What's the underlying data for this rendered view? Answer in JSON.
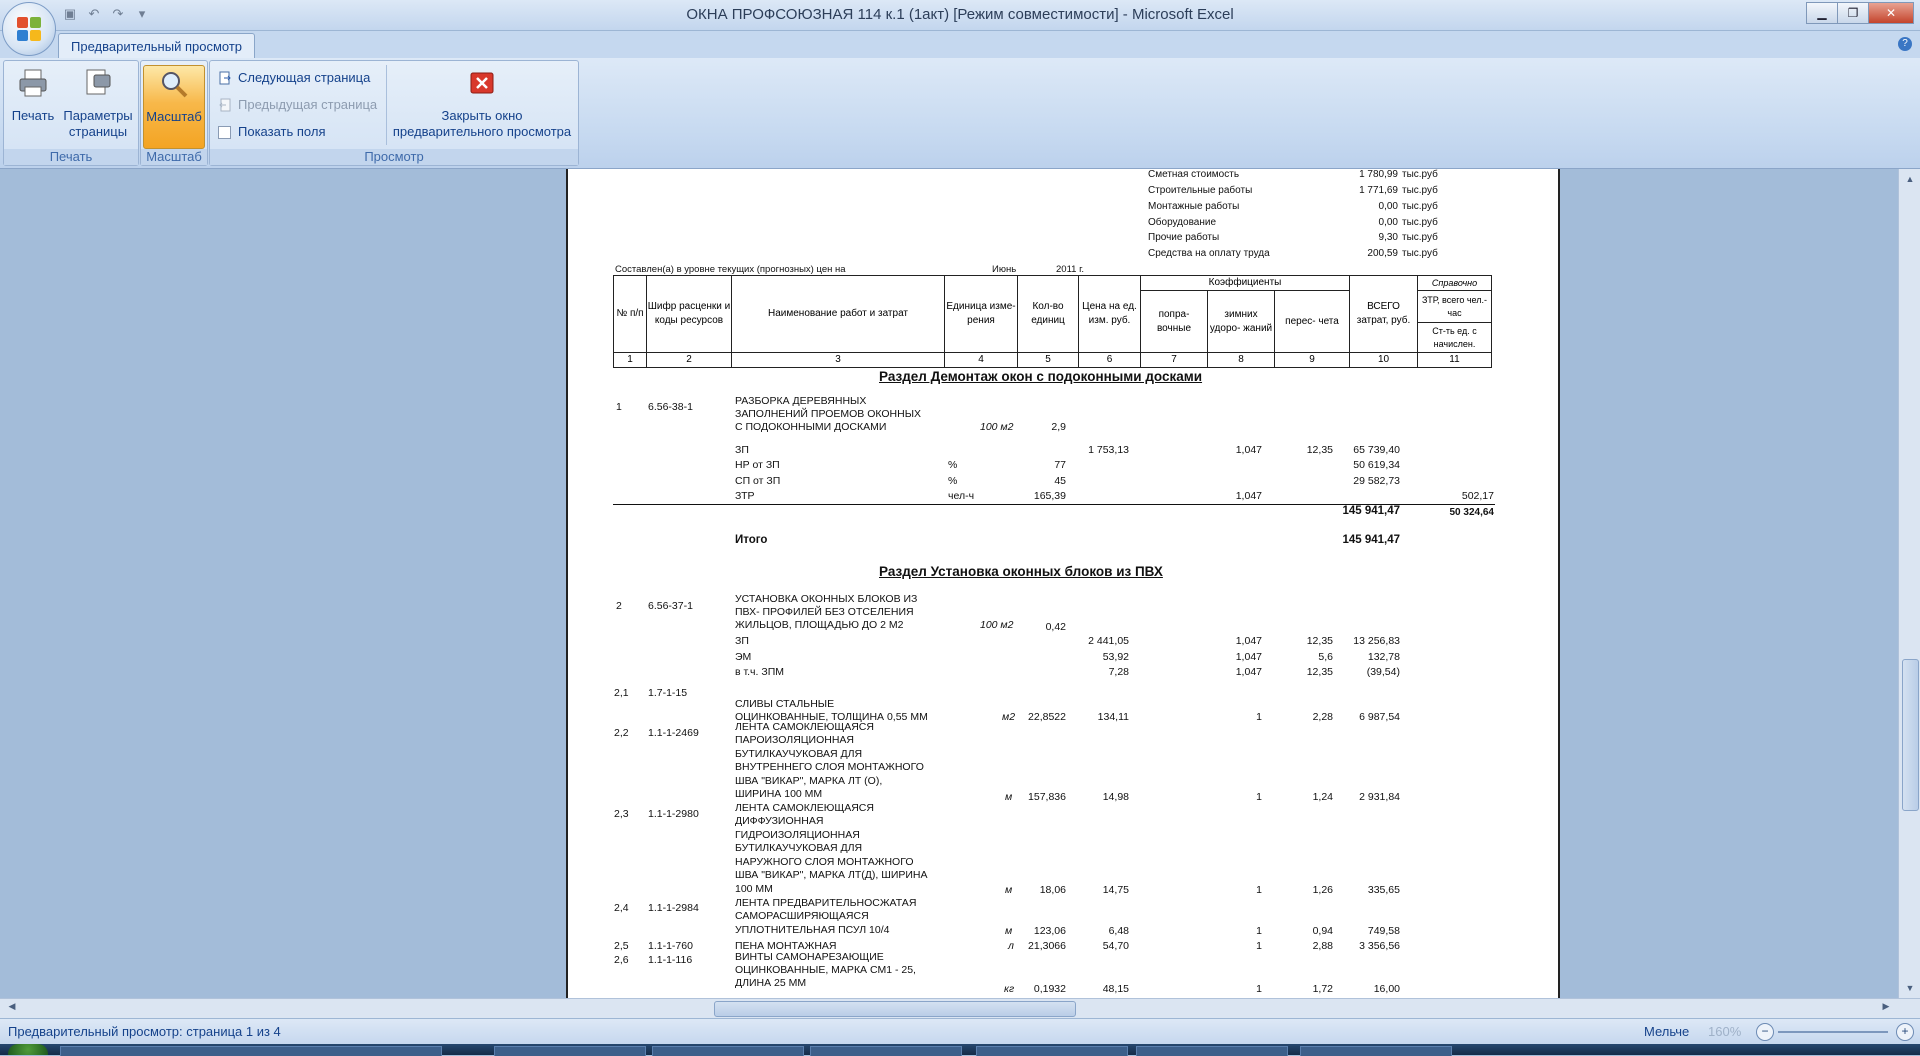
{
  "window": {
    "title": "ОКНА ПРОФСОЮЗНАЯ 114 к.1 (1акт)  [Режим совместимости]  - Microsoft Excel"
  },
  "ribbon": {
    "tab": "Предварительный просмотр",
    "print_label": "Печать",
    "page_setup_label": "Параметры страницы",
    "zoom_label": "Масштаб",
    "next_page": "Следующая страница",
    "prev_page": "Предыдущая страница",
    "show_margins": "Показать поля",
    "close_preview": "Закрыть окно предварительного просмотра",
    "group_print": "Печать",
    "group_zoom": "Масштаб",
    "group_preview": "Просмотр"
  },
  "status": {
    "text": "Предварительный просмотр: страница 1 из 4",
    "zoom_label": "Мельче",
    "zoom_value": "160%"
  },
  "sheet": {
    "summary": [
      {
        "label": "Сметная стоимость",
        "value": "1 780,99",
        "unit": "тыс.руб"
      },
      {
        "label": "Строительные работы",
        "value": "1 771,69",
        "unit": "тыс.руб"
      },
      {
        "label": "Монтажные работы",
        "value": "0,00",
        "unit": "тыс.руб"
      },
      {
        "label": "Оборудование",
        "value": "0,00",
        "unit": "тыс.руб"
      },
      {
        "label": "Прочие работы",
        "value": "9,30",
        "unit": "тыс.руб"
      },
      {
        "label": "Средства на оплату труда",
        "value": "200,59",
        "unit": "тыс.руб"
      }
    ],
    "compiled_text": "Составлен(а) в уровне текущих (прогнозных) цен на",
    "compiled_month": "Июнь",
    "compiled_year": "2011  г.",
    "headers": {
      "n": "№ п/п",
      "code": "Шифр расценки и коды ресурсов",
      "name": "Наименование работ и затрат",
      "unit": "Единица изме- рения",
      "qty": "Кол-во единиц",
      "price": "Цена на ед. изм. руб.",
      "coef": "Коэффициенты",
      "c1": "попра- вочные",
      "c2": "зимних удоро- жаний",
      "c3": "перес- чета",
      "total": "ВСЕГО затрат, руб.",
      "ref": "Справочно",
      "ztr": "ЗТР, всего чел.-час",
      "st": "Ст-ть ед. с начислен."
    },
    "col_numbers": [
      "1",
      "2",
      "3",
      "4",
      "5",
      "6",
      "7",
      "8",
      "9",
      "10",
      "11"
    ],
    "section1": "Раздел   Демонтаж окон с подоконными досками",
    "section2": "Раздел   Установка оконных блоков из ПВХ",
    "rows": {
      "r1": {
        "n": "1",
        "code": "6.56-38-1",
        "name1": "РАЗБОРКА ДЕРЕВЯННЫХ",
        "name2": "ЗАПОЛНЕНИЙ ПРОЕМОВ ОКОННЫХ",
        "name3": "С ПОДОКОННЫМИ ДОСКАМИ",
        "unit": "100 м2",
        "qty": "2,9"
      },
      "r1_zp": {
        "name": "ЗП",
        "price": "1 753,13",
        "c2": "1,047",
        "c3": "12,35",
        "total": "65 739,40"
      },
      "r1_nr": {
        "name": "НР от ЗП",
        "unit": "%",
        "qty": "77",
        "total": "50 619,34"
      },
      "r1_sp": {
        "name": "СП от ЗП",
        "unit": "%",
        "qty": "45",
        "total": "29 582,73"
      },
      "r1_ztr": {
        "name": "ЗТР",
        "unit": "чел-ч",
        "qty": "165,39",
        "c2": "1,047",
        "ref": "502,17"
      },
      "r1_sum": {
        "total": "145 941,47",
        "ref": "50 324,64"
      },
      "itogo": {
        "name": "Итого",
        "total": "145 941,47"
      },
      "r2": {
        "n": "2",
        "code": "6.56-37-1",
        "name1": "УСТАНОВКА ОКОННЫХ БЛОКОВ ИЗ",
        "name2": "ПВХ- ПРОФИЛЕЙ БЕЗ ОТСЕЛЕНИЯ",
        "name3": "ЖИЛЬЦОВ, ПЛОЩАДЬЮ ДО 2 М2",
        "unit": "100 м2",
        "qty": "0,42"
      },
      "r2_zp": {
        "name": "ЗП",
        "price": "2 441,05",
        "c2": "1,047",
        "c3": "12,35",
        "total": "13 256,83"
      },
      "r2_em": {
        "name": "ЭМ",
        "price": "53,92",
        "c2": "1,047",
        "c3": "5,6",
        "total": "132,78"
      },
      "r2_zpm": {
        "name": "в т.ч. ЗПМ",
        "price": "7,28",
        "c2": "1,047",
        "c3": "12,35",
        "total": "(39,54)"
      },
      "r21": {
        "n": "2,1",
        "code": "1.7-1-15",
        "name1": "СЛИВЫ СТАЛЬНЫЕ",
        "name2": "ОЦИНКОВАННЫЕ, ТОЛЩИНА 0,55 ММ",
        "unit": "м2",
        "qty": "22,8522",
        "price": "134,11",
        "c2": "1",
        "c3": "2,28",
        "total": "6 987,54"
      },
      "r22": {
        "n": "2,2",
        "code": "1.1-1-2469",
        "name1": "ЛЕНТА САМОКЛЕЮЩАЯСЯ",
        "name2": "ПАРОИЗОЛЯЦИОННАЯ",
        "name3": "БУТИЛКАУЧУКОВАЯ ДЛЯ",
        "name4": "ВНУТРЕННЕГО СЛОЯ МОНТАЖНОГО",
        "name5": "ШВА \"ВИКАР\", МАРКА ЛТ (О),",
        "name6": "ШИРИНА 100 ММ",
        "unit": "м",
        "qty": "157,836",
        "price": "14,98",
        "c2": "1",
        "c3": "1,24",
        "total": "2 931,84"
      },
      "r23": {
        "n": "2,3",
        "code": "1.1-1-2980",
        "name1": "ЛЕНТА САМОКЛЕЮЩАЯСЯ",
        "name2": "ДИФФУЗИОННАЯ",
        "name3": "ГИДРОИЗОЛЯЦИОННАЯ",
        "name4": "БУТИЛКАУЧУКОВАЯ ДЛЯ",
        "name5": "НАРУЖНОГО СЛОЯ МОНТАЖНОГО",
        "name6": "ШВА \"ВИКАР\", МАРКА ЛТ(Д), ШИРИНА",
        "name7": "100 ММ",
        "unit": "м",
        "qty": "18,06",
        "price": "14,75",
        "c2": "1",
        "c3": "1,26",
        "total": "335,65"
      },
      "r24": {
        "n": "2,4",
        "code": "1.1-1-2984",
        "name1": "ЛЕНТА ПРЕДВАРИТЕЛЬНОСЖАТАЯ",
        "name2": "САМОРАСШИРЯЮЩАЯСЯ",
        "name3": "УПЛОТНИТЕЛЬНАЯ ПСУЛ 10/4",
        "unit": "м",
        "qty": "123,06",
        "price": "6,48",
        "c2": "1",
        "c3": "0,94",
        "total": "749,58"
      },
      "r25": {
        "n": "2,5",
        "code": "1.1-1-760",
        "name1": "ПЕНА МОНТАЖНАЯ",
        "unit": "л",
        "qty": "21,3066",
        "price": "54,70",
        "c2": "1",
        "c3": "2,88",
        "total": "3 356,56"
      },
      "r26": {
        "n": "2,6",
        "code": "1.1-1-116",
        "name1": "ВИНТЫ САМОНАРЕЗАЮЩИЕ",
        "name2": "ОЦИНКОВАННЫЕ, МАРКА СМ1 - 25,",
        "name3": "ДЛИНА 25 ММ",
        "unit": "кг",
        "qty": "0,1932",
        "price": "48,15",
        "c2": "1",
        "c3": "1,72",
        "total": "16,00"
      }
    }
  }
}
